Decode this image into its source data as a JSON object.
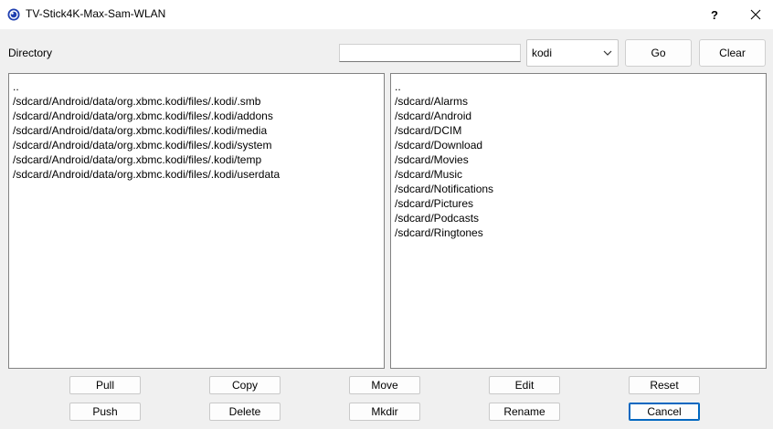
{
  "window": {
    "title": "TV-Stick4K-Max-Sam-WLAN",
    "icon": "app-globe-icon",
    "help_label": "?",
    "close_label": "✕"
  },
  "toolbar": {
    "directory_label": "Directory",
    "directory_value": "",
    "combo_value": "kodi",
    "go_label": "Go",
    "clear_label": "Clear"
  },
  "left_list": {
    "items": [
      "..",
      "/sdcard/Android/data/org.xbmc.kodi/files/.kodi/.smb",
      "/sdcard/Android/data/org.xbmc.kodi/files/.kodi/addons",
      "/sdcard/Android/data/org.xbmc.kodi/files/.kodi/media",
      "/sdcard/Android/data/org.xbmc.kodi/files/.kodi/system",
      "/sdcard/Android/data/org.xbmc.kodi/files/.kodi/temp",
      "/sdcard/Android/data/org.xbmc.kodi/files/.kodi/userdata"
    ]
  },
  "right_list": {
    "items": [
      "..",
      "/sdcard/Alarms",
      "/sdcard/Android",
      "/sdcard/DCIM",
      "/sdcard/Download",
      "/sdcard/Movies",
      "/sdcard/Music",
      "/sdcard/Notifications",
      "/sdcard/Pictures",
      "/sdcard/Podcasts",
      "/sdcard/Ringtones"
    ]
  },
  "actions": {
    "pull": "Pull",
    "copy": "Copy",
    "move": "Move",
    "edit": "Edit",
    "reset": "Reset",
    "push": "Push",
    "delete": "Delete",
    "mkdir": "Mkdir",
    "rename": "Rename",
    "cancel": "Cancel"
  },
  "colors": {
    "window_bg": "#f0f0f0",
    "default_button_border": "#0067c0",
    "list_border": "#828282"
  }
}
